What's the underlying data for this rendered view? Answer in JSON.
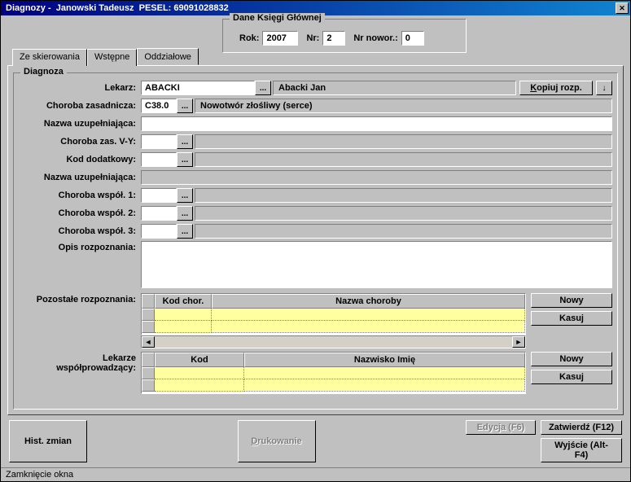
{
  "title": "Diagnozy -  Janowski Tadeusz  PESEL: 69091028832",
  "dane": {
    "legend": "Dane Księgi Głównej",
    "rok_label": "Rok:",
    "rok": "2007",
    "nr_label": "Nr:",
    "nr": "2",
    "nowor_label": "Nr nowor.:",
    "nowor": "0"
  },
  "tabs": {
    "t1": "Ze skierowania",
    "t2": "Wstępne",
    "t3": "Oddziałowe"
  },
  "diag": {
    "legend": "Diagnoza",
    "lekarz_label": "Lekarz:",
    "lekarz_code": "ABACKI",
    "lekarz_name": "Abacki Jan",
    "kopiuj": "Kopiuj rozp.",
    "arrow": "↓",
    "zasad_label": "Choroba zasadnicza:",
    "zasad_code": "C38.0",
    "zasad_desc": "Nowotwór złośliwy (serce)",
    "nazwa1_label": "Nazwa uzupełniająca:",
    "vy_label": "Choroba zas. V-Y:",
    "koddod_label": "Kod dodatkowy:",
    "nazwa2_label": "Nazwa uzupełniająca:",
    "wspol1_label": "Choroba współ. 1:",
    "wspol2_label": "Choroba współ. 2:",
    "wspol3_label": "Choroba współ. 3:",
    "opis_label": "Opis rozpoznania:",
    "pozostale_label": "Pozostałe rozpoznania:",
    "lekarze_label1": "Lekarze",
    "lekarze_label2": "współprowadzący:",
    "grid1_col1": "Kod chor.",
    "grid1_col2": "Nazwa choroby",
    "grid2_col1": "Kod",
    "grid2_col2": "Nazwisko Imię",
    "nowy": "Nowy",
    "kasuj": "Kasuj",
    "ellipsis": "..."
  },
  "footer": {
    "hist": "Hist. zmian",
    "druk": "Drukowanie",
    "edycja": "Edycja (F6)",
    "zatw": "Zatwierdź (F12)",
    "wyjscie": "Wyjście (Alt-F4)"
  },
  "status": "Zamknięcie okna"
}
